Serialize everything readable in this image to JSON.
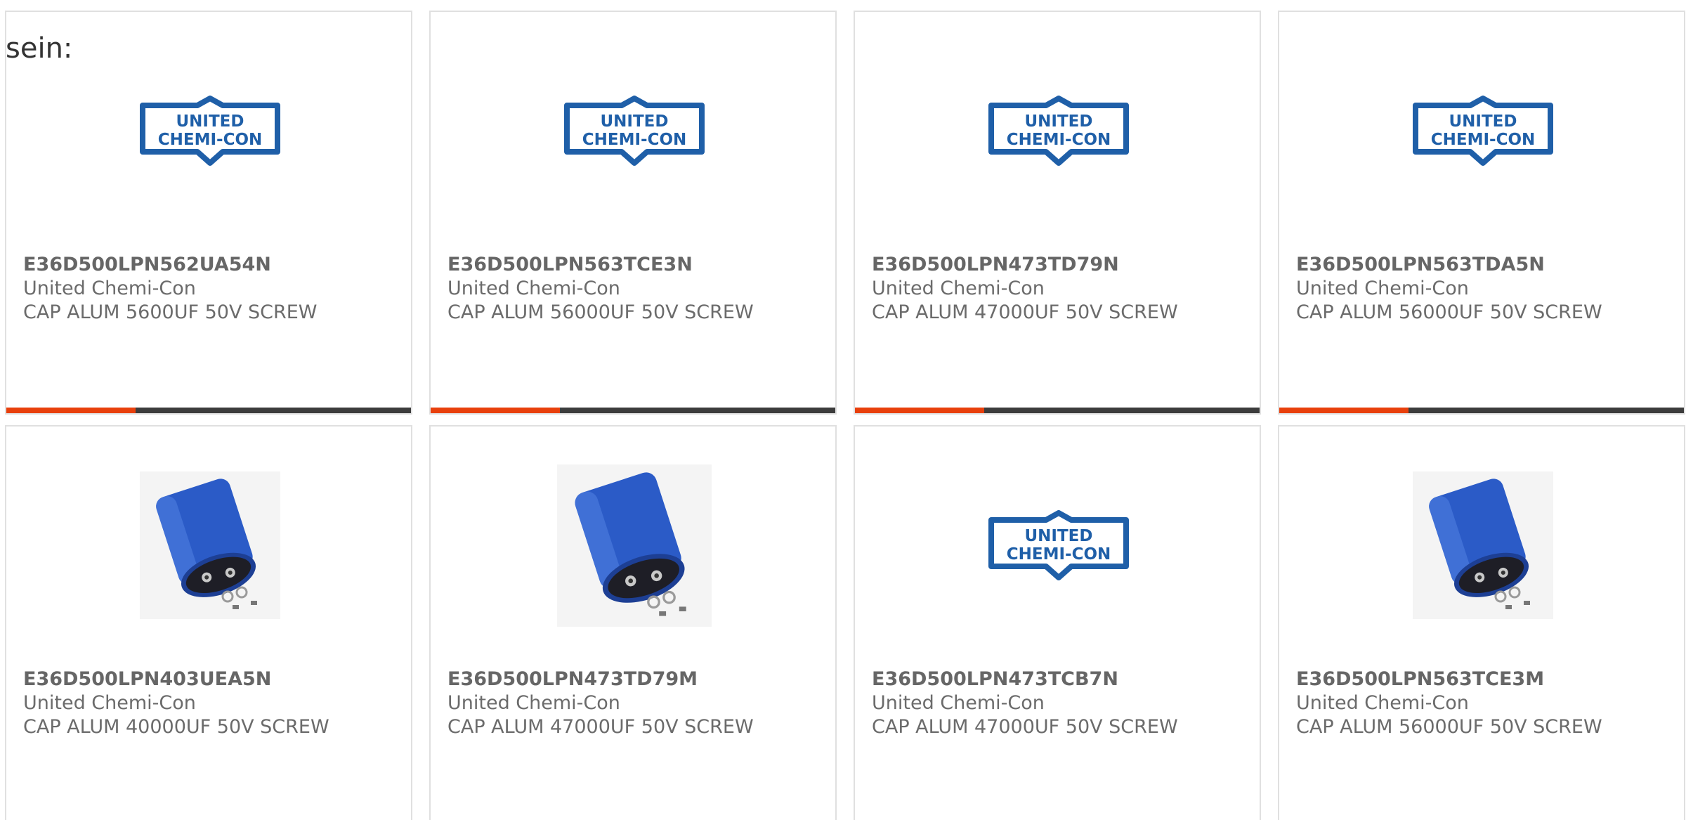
{
  "intro_text": "sein:",
  "colors": {
    "bar_accent": "#e8400c",
    "bar_dark": "#3c3c3c",
    "logo_blue": "#1f5fa8",
    "capacitor_blue": "#2b5bc7"
  },
  "logo_text": [
    "UNITED",
    "CHEMI-CON"
  ],
  "products": [
    {
      "part_number": "E36D500LPN562UA54N",
      "manufacturer": "United Chemi-Con",
      "description": "CAP ALUM 5600UF 50V SCREW",
      "image": "united-chemi-con-logo",
      "progress": 0.32
    },
    {
      "part_number": "E36D500LPN563TCE3N",
      "manufacturer": "United Chemi-Con",
      "description": "CAP ALUM 56000UF 50V SCREW",
      "image": "united-chemi-con-logo",
      "progress": 0.32
    },
    {
      "part_number": "E36D500LPN473TD79N",
      "manufacturer": "United Chemi-Con",
      "description": "CAP ALUM 47000UF 50V SCREW",
      "image": "united-chemi-con-logo",
      "progress": 0.32
    },
    {
      "part_number": "E36D500LPN563TDA5N",
      "manufacturer": "United Chemi-Con",
      "description": "CAP ALUM 56000UF 50V SCREW",
      "image": "united-chemi-con-logo",
      "progress": 0.32
    },
    {
      "part_number": "E36D500LPN403UEA5N",
      "manufacturer": "United Chemi-Con",
      "description": "CAP ALUM 40000UF 50V SCREW",
      "image": "capacitor-photo",
      "progress": null
    },
    {
      "part_number": "E36D500LPN473TD79M",
      "manufacturer": "United Chemi-Con",
      "description": "CAP ALUM 47000UF 50V SCREW",
      "image": "capacitor-photo-large",
      "progress": null
    },
    {
      "part_number": "E36D500LPN473TCB7N",
      "manufacturer": "United Chemi-Con",
      "description": "CAP ALUM 47000UF 50V SCREW",
      "image": "united-chemi-con-logo",
      "progress": null
    },
    {
      "part_number": "E36D500LPN563TCE3M",
      "manufacturer": "United Chemi-Con",
      "description": "CAP ALUM 56000UF 50V SCREW",
      "image": "capacitor-photo",
      "progress": null
    }
  ]
}
